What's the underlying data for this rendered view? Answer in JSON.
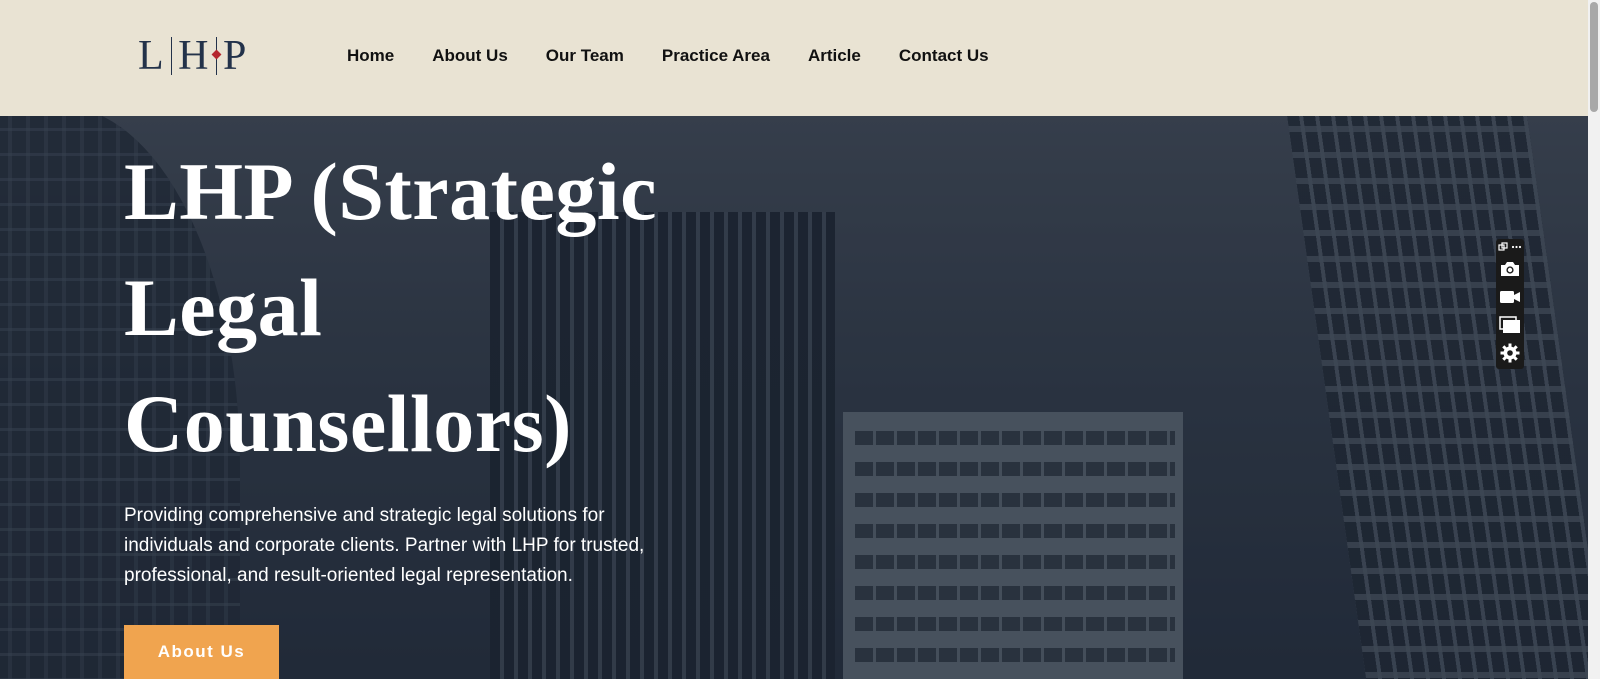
{
  "logo": {
    "letters": [
      "L",
      "H",
      "P"
    ]
  },
  "nav": {
    "items": [
      {
        "label": "Home"
      },
      {
        "label": "About Us"
      },
      {
        "label": "Our Team"
      },
      {
        "label": "Practice Area"
      },
      {
        "label": "Article"
      },
      {
        "label": "Contact Us"
      }
    ]
  },
  "hero": {
    "title_lines": [
      "LHP (Strategic",
      "Legal",
      "Counsellors)"
    ],
    "description": "Providing comprehensive and strategic legal solutions for individuals and corporate clients. Partner with LHP for trusted, professional, and result-oriented legal representation.",
    "cta_label": "About Us"
  },
  "toolbar": {
    "icons": [
      "screenshot-camera-icon",
      "video-record-icon",
      "window-capture-icon",
      "settings-gear-icon"
    ]
  },
  "colors": {
    "header_bg": "#e9e3d3",
    "logo_text": "#23324a",
    "logo_accent": "#b5262d",
    "cta_bg": "#f0a44f",
    "hero_text": "#ffffff"
  }
}
